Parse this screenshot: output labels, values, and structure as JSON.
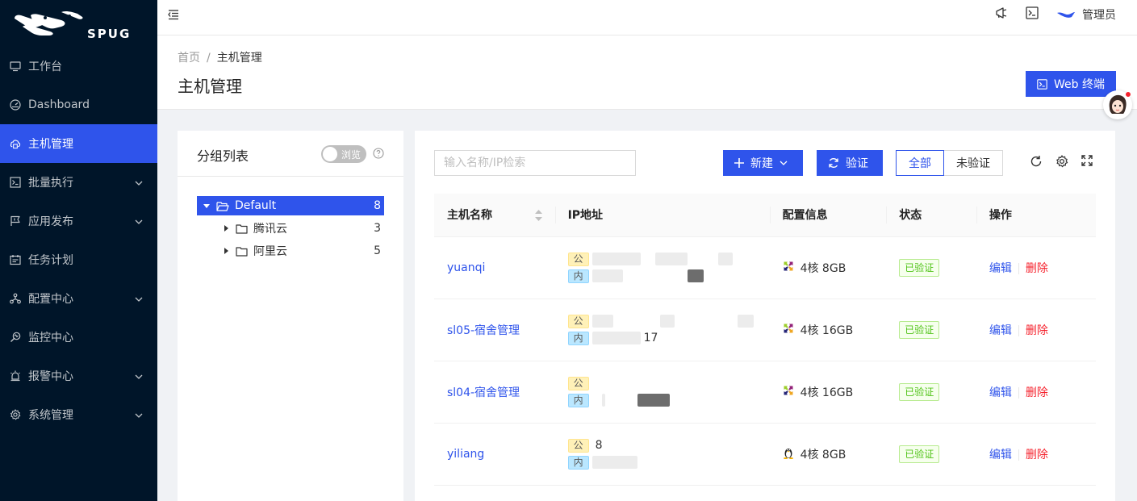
{
  "sidebar": {
    "logo_text": "SPUG",
    "items": [
      {
        "label": "工作台",
        "icon": "desktop-icon",
        "expandable": false
      },
      {
        "label": "Dashboard",
        "icon": "dashboard-icon",
        "expandable": false
      },
      {
        "label": "主机管理",
        "icon": "cloud-server-icon",
        "expandable": false,
        "active": true
      },
      {
        "label": "批量执行",
        "icon": "terminal-icon",
        "expandable": true
      },
      {
        "label": "应用发布",
        "icon": "flag-icon",
        "expandable": true
      },
      {
        "label": "任务计划",
        "icon": "schedule-icon",
        "expandable": false
      },
      {
        "label": "配置中心",
        "icon": "deployment-icon",
        "expandable": true
      },
      {
        "label": "监控中心",
        "icon": "monitor-icon",
        "expandable": false
      },
      {
        "label": "报警中心",
        "icon": "alert-icon",
        "expandable": true
      },
      {
        "label": "系统管理",
        "icon": "setting-icon",
        "expandable": true
      }
    ]
  },
  "topbar": {
    "user_name": "管理员"
  },
  "page": {
    "breadcrumb": [
      "首页",
      "主机管理"
    ],
    "breadcrumb_sep": "/",
    "title": "主机管理",
    "web_terminal_label": "Web 终端"
  },
  "groups": {
    "title": "分组列表",
    "switch_label": "浏览",
    "tree": [
      {
        "label": "Default",
        "count": "8",
        "selected": true
      },
      {
        "label": "腾讯云",
        "count": "3"
      },
      {
        "label": "阿里云",
        "count": "5"
      }
    ]
  },
  "hosts": {
    "search_placeholder": "输入名称/IP检索",
    "new_label": "新建",
    "verify_label": "验证",
    "filter_all": "全部",
    "filter_unverified": "未验证",
    "columns": [
      "主机名称",
      "IP地址",
      "配置信息",
      "状态",
      "操作"
    ],
    "ip_public_tag": "公",
    "ip_private_tag": "内",
    "edit_label": "编辑",
    "delete_label": "删除",
    "rows": [
      {
        "name": "yuanqi",
        "config": "4核 8GB",
        "os": "centos",
        "status": "已验证",
        "pub_text": "",
        "pri_text": ""
      },
      {
        "name": "sl05-宿舍管理",
        "config": "4核 16GB",
        "os": "centos",
        "status": "已验证",
        "pub_text": "",
        "pri_text": "17"
      },
      {
        "name": "sl04-宿舍管理",
        "config": "4核 16GB",
        "os": "centos",
        "status": "已验证",
        "pub_text": "",
        "pri_text": ""
      },
      {
        "name": "yiliang",
        "config": "4核 8GB",
        "os": "linux",
        "status": "已验证",
        "pub_text": "8",
        "pri_text": ""
      }
    ]
  },
  "colors": {
    "primary": "#2f54eb",
    "sidebar_bg": "#001529",
    "danger": "#f5222d",
    "success": "#52c41a"
  }
}
